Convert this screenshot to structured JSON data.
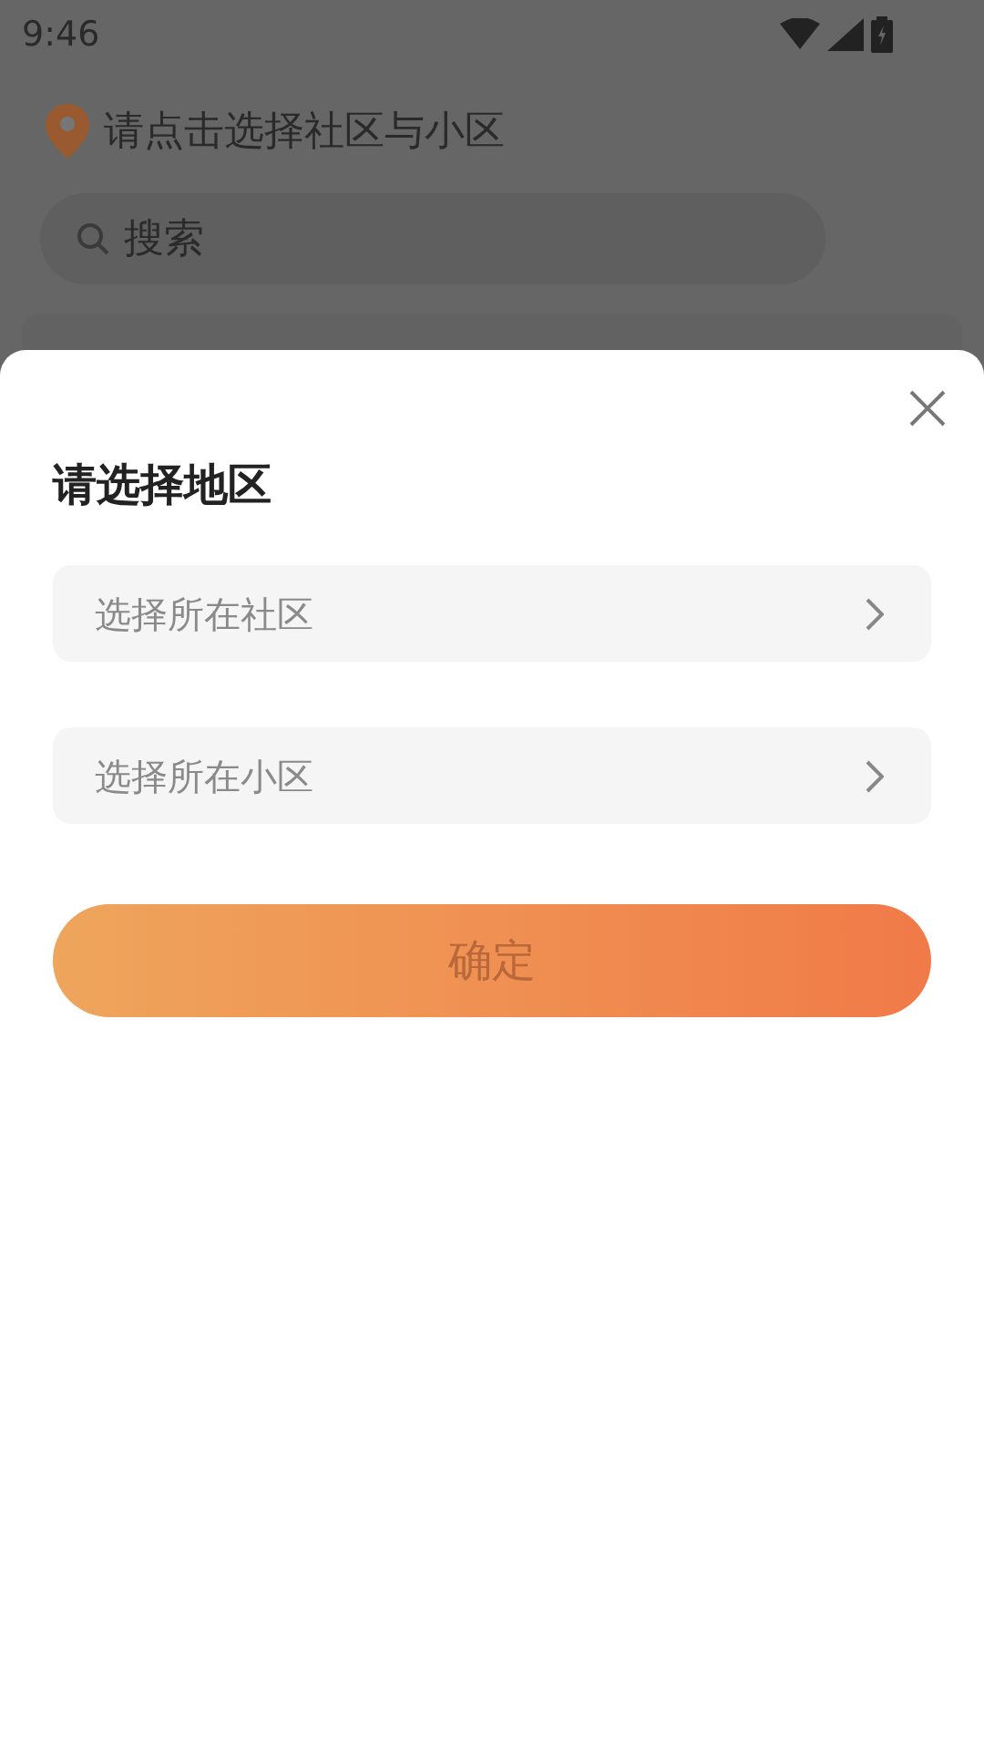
{
  "status_bar": {
    "time": "9:46"
  },
  "location": {
    "label": "请点击选择社区与小区"
  },
  "search": {
    "placeholder": "搜索"
  },
  "sheet": {
    "title": "请选择地区",
    "selectors": [
      {
        "placeholder": "选择所在社区"
      },
      {
        "placeholder": "选择所在小区"
      }
    ],
    "confirm": {
      "label": "确定",
      "disabled": true
    }
  }
}
